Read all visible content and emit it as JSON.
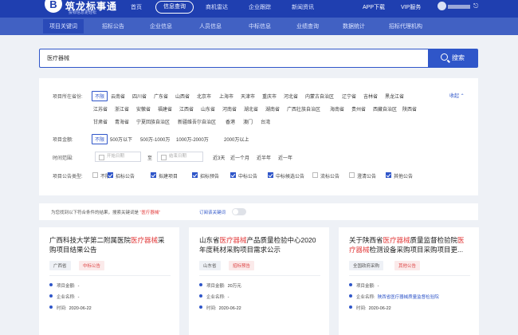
{
  "brand": {
    "logo_letter": "B",
    "name": "筑龙标事通",
    "slogan": "投标信息更轻松"
  },
  "nav": {
    "items": [
      "首页",
      "信息查询",
      "商机雷达",
      "企业跟踪",
      "新闻资讯"
    ],
    "active": "信息查询",
    "app_download": "APP下载",
    "vip": "VIP服务"
  },
  "subnav": {
    "items": [
      "项目关键词",
      "招标公告",
      "企业信息",
      "人员信息",
      "中标信息",
      "业绩查询",
      "数据统计",
      "招标代理机构"
    ]
  },
  "search": {
    "value": "医疗器械",
    "button_label": "搜索"
  },
  "filters": {
    "region_label": "项目所在省份:",
    "regions_row1": [
      "不限",
      "云南省",
      "四川省",
      "广东省",
      "山西省",
      "北京市",
      "上海市",
      "天津市",
      "重庆市",
      "河北省",
      "内蒙古自治区",
      "辽宁省",
      "吉林省",
      "黑龙江省"
    ],
    "regions_row2": [
      "江苏省",
      "浙江省",
      "安徽省",
      "福建省",
      "江西省",
      "山东省",
      "河南省",
      "湖北省",
      "湖南省",
      "广西壮族自治区",
      "海南省",
      "贵州省",
      "西藏自治区",
      "陕西省"
    ],
    "regions_row3": [
      "甘肃省",
      "青海省",
      "宁夏回族自治区",
      "新疆维吾尔自治区",
      "香港",
      "澳门",
      "台湾"
    ],
    "collapse": "收起",
    "amount_label": "项目金额:",
    "amounts": [
      "不限",
      "500万以下",
      "500万-1000万",
      "1000万-2000万",
      "2000万以上"
    ],
    "time_label": "时间范围:",
    "start_placeholder": "开始日期",
    "to": "至",
    "end_placeholder": "结束日期",
    "time_quick": [
      "近3天",
      "近一个月",
      "近半年",
      "近一年"
    ],
    "type_label": "项目公告类型:",
    "types": [
      {
        "label": "不限",
        "checked": false
      },
      {
        "label": "招标公告",
        "checked": true
      },
      {
        "label": "拟建项目",
        "checked": true
      },
      {
        "label": "招标预告",
        "checked": true
      },
      {
        "label": "中标公告",
        "checked": true
      },
      {
        "label": "中标候选公告",
        "checked": true
      },
      {
        "label": "流标公告",
        "checked": false
      },
      {
        "label": "澄清公告",
        "checked": false
      },
      {
        "label": "其他公告",
        "checked": true
      }
    ]
  },
  "result": {
    "prefix": "为您找到以下符合条件的结果，搜索关键词是",
    "keyword": "“医疗器械”",
    "subscribe": "订阅该关键词"
  },
  "cards": [
    {
      "title_pre": "广西科技大学第二附属医院",
      "title_hl": "医疗器械",
      "title_post": "采购项目结果公告",
      "region": "广西省",
      "kind": "中标公告",
      "amount_label": "项目金额:",
      "amount": "-",
      "company_label": "企业名称:",
      "company": "-",
      "time_label": "时间:",
      "time": "2020-06-22"
    },
    {
      "title_pre": "山东省",
      "title_hl": "医疗器械",
      "title_post": "产品质量检验中心2020年度耗材采购项目需求公示",
      "region": "山东省",
      "kind": "招标预告",
      "amount_label": "项目金额:",
      "amount": "20万元",
      "company_label": "企业名称:",
      "company": "-",
      "time_label": "时间:",
      "time": "2020-06-22"
    },
    {
      "title_pre": "关于陕西省",
      "title_hl": "医疗器械",
      "title_mid": "质量监督检验院",
      "title_hl2": "医疗器械",
      "title_post": "检测设备采购项目采购项目更...",
      "region": "全国政府采购",
      "kind": "其他公告",
      "amount_label": "项目金额:",
      "amount": "-",
      "company_label": "企业名称:",
      "company": "陕西省医疗器械质量监督检验院",
      "time_label": "时间:",
      "time": "2020-06-22"
    }
  ],
  "colors": {
    "primary": "#2f56c9",
    "nav_bg": "#1f3fb0",
    "highlight": "#e23d3d"
  }
}
